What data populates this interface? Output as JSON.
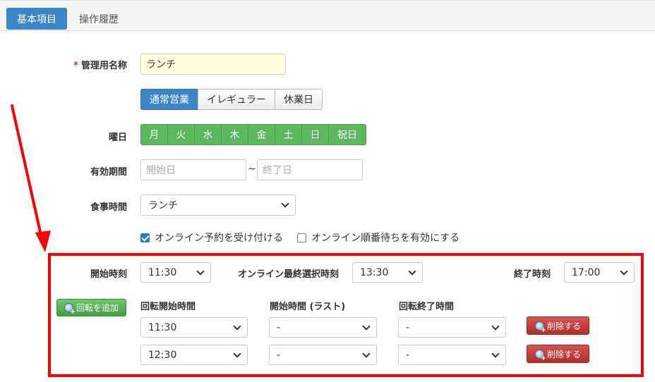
{
  "tabs": [
    {
      "label": "基本項目",
      "active": true
    },
    {
      "label": "操作履歴",
      "active": false
    }
  ],
  "form": {
    "name_label": "管理用名称",
    "required_mark": "*",
    "name_value": "ランチ",
    "mode_options": [
      {
        "label": "通常営業",
        "active": true
      },
      {
        "label": "イレギュラー",
        "active": false
      },
      {
        "label": "休業日",
        "active": false
      }
    ],
    "weekday_label": "曜日",
    "weekdays": [
      "月",
      "火",
      "水",
      "木",
      "金",
      "土",
      "日",
      "祝日"
    ],
    "period_label": "有効期間",
    "period_start_placeholder": "開始日",
    "period_separator": "~",
    "period_end_placeholder": "終了日",
    "meal_label": "食事時間",
    "meal_value": "ランチ",
    "online_reservation_label": "オンライン予約を受け付ける",
    "online_reservation_checked": true,
    "online_queue_label": "オンライン順番待ちを有効にする",
    "online_queue_checked": false
  },
  "schedule": {
    "start_label": "開始時刻",
    "start_value": "11:30",
    "online_last_label": "オンライン最終選択時刻",
    "online_last_value": "13:30",
    "end_label": "終了時刻",
    "end_value": "17:00",
    "add_rotation_label": "回転を追加",
    "col_start": "回転開始時間",
    "col_last": "開始時間 (ラスト)",
    "col_end": "回転終了時間",
    "rows": [
      {
        "start": "11:30",
        "last": "-",
        "end": "-",
        "delete_label": "削除する"
      },
      {
        "start": "12:30",
        "last": "-",
        "end": "-",
        "delete_label": "削除する"
      }
    ]
  },
  "colors": {
    "primary": "#3a86c8",
    "success": "#5cb85c",
    "danger": "#d9534f",
    "highlight": "#ff0000"
  }
}
